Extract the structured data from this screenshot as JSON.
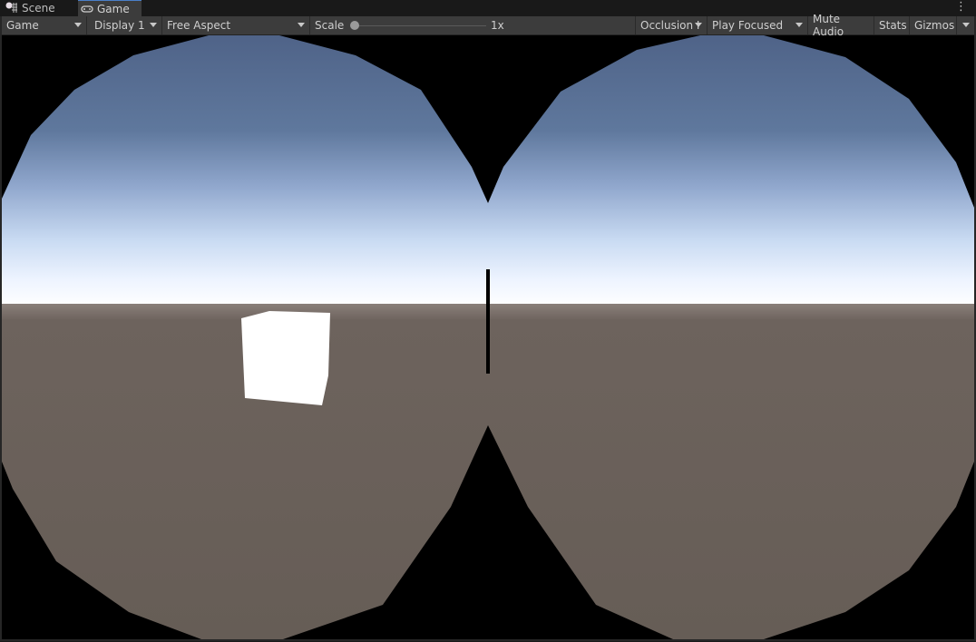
{
  "tabs": [
    {
      "label": "Scene",
      "icon": "scene-grid-icon"
    },
    {
      "label": "Game",
      "icon": "gamepad-icon",
      "active": true
    }
  ],
  "menu_icon": "kebab-menu-icon",
  "toolbar": {
    "mode_dropdown": "Game",
    "display_dropdown": "Display 1",
    "aspect_dropdown": "Free Aspect",
    "scale_label": "Scale",
    "scale_value": "1x",
    "scale_fraction": 0,
    "occlusion_dropdown": "Occlusion I",
    "play_mode_dropdown": "Play Focused",
    "mute_audio": "Mute Audio",
    "stats": "Stats",
    "gizmos": "Gizmos"
  },
  "viewport": {
    "content": "stereo-fisheye-render",
    "colors": {
      "sky_top": "#5a6e91",
      "sky_horizon": "#e6f0ff",
      "ground": "#6b615b",
      "background": "#000000",
      "cube": "#ffffff"
    }
  }
}
